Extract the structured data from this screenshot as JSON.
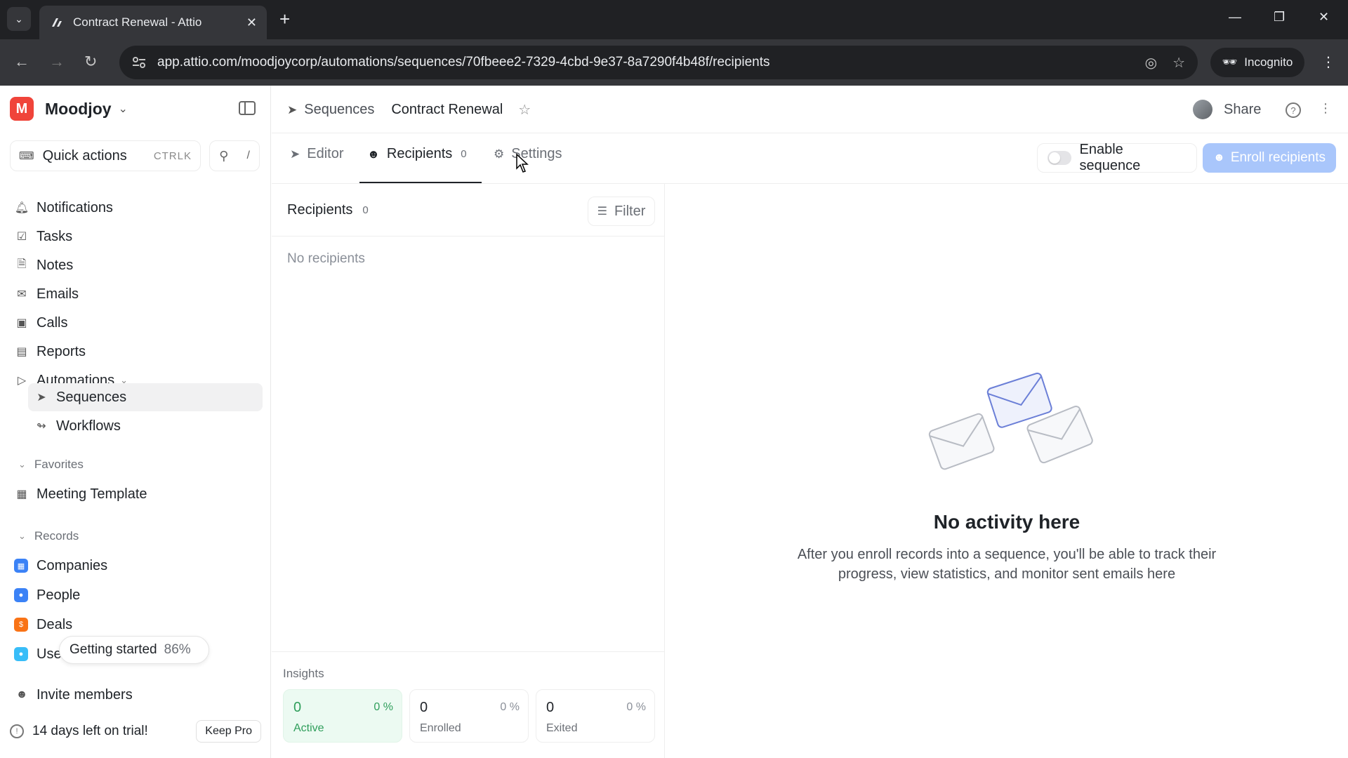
{
  "browser": {
    "tab_title": "Contract Renewal - Attio",
    "url": "app.attio.com/moodjoycorp/automations/sequences/70fbeee2-7329-4cbd-9e37-8a7290f4b48f/recipients",
    "incognito_label": "Incognito"
  },
  "workspace": {
    "logo_letter": "M",
    "name": "Moodjoy",
    "brand_color": "#f0443a"
  },
  "sidebar": {
    "quick_actions": "Quick actions",
    "quick_kbd": "CTRLK",
    "search_kbd": "/",
    "nav": [
      {
        "label": "Notifications",
        "icon": "bell-icon"
      },
      {
        "label": "Tasks",
        "icon": "checkbox-icon"
      },
      {
        "label": "Notes",
        "icon": "note-icon"
      },
      {
        "label": "Emails",
        "icon": "mail-icon"
      },
      {
        "label": "Calls",
        "icon": "video-icon"
      },
      {
        "label": "Reports",
        "icon": "chart-icon"
      },
      {
        "label": "Automations",
        "icon": "play-icon"
      }
    ],
    "automations_sub": [
      {
        "label": "Sequences",
        "icon": "send-icon",
        "active": true
      },
      {
        "label": "Workflows",
        "icon": "workflow-icon",
        "active": false
      }
    ],
    "favorites_title": "Favorites",
    "favorites": [
      {
        "label": "Meeting Template",
        "icon": "calendar-icon"
      }
    ],
    "records_title": "Records",
    "records": [
      {
        "label": "Companies",
        "color": "#3b82f6"
      },
      {
        "label": "People",
        "color": "#3b82f6"
      },
      {
        "label": "Deals",
        "color": "#f97316"
      },
      {
        "label": "Use",
        "color": "#38bdf8"
      }
    ],
    "getting_started": "Getting started",
    "getting_started_pct": "86%",
    "invite": "Invite members",
    "trial": "14 days left on trial!",
    "keep_pro": "Keep Pro"
  },
  "header": {
    "crumb_parent": "Sequences",
    "crumb_current": "Contract Renewal",
    "share": "Share"
  },
  "tabs": {
    "editor": "Editor",
    "recipients": "Recipients",
    "recipients_count": "0",
    "settings": "Settings",
    "enable_sequence": "Enable sequence",
    "enroll": "Enroll recipients"
  },
  "recipients": {
    "title": "Recipients",
    "count": "0",
    "filter": "Filter",
    "empty": "No recipients"
  },
  "insights": {
    "title": "Insights",
    "stats": [
      {
        "value": "0",
        "pct": "0 %",
        "label": "Active"
      },
      {
        "value": "0",
        "pct": "0 %",
        "label": "Enrolled"
      },
      {
        "value": "0",
        "pct": "0 %",
        "label": "Exited"
      }
    ]
  },
  "empty_state": {
    "title": "No activity here",
    "description": "After you enroll records into a sequence, you'll be able to track their progress, view statistics, and monitor sent emails here"
  }
}
